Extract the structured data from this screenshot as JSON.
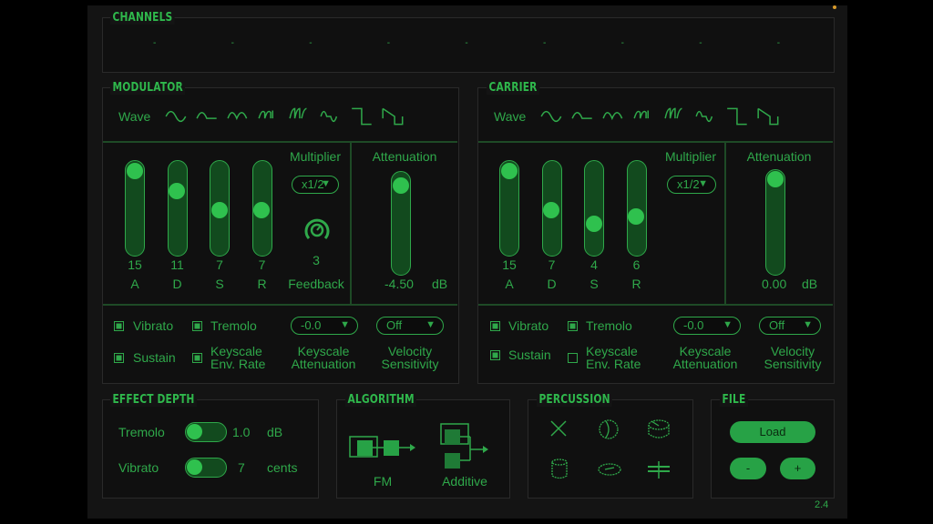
{
  "version": "2.4",
  "channels": {
    "title": "CHANNELS",
    "slots": [
      "-",
      "-",
      "-",
      "-",
      "-",
      "-",
      "-",
      "-",
      "-"
    ]
  },
  "modulator": {
    "title": "MODULATOR",
    "wave_label": "Wave",
    "adsr": {
      "labels": [
        "A",
        "D",
        "S",
        "R"
      ],
      "values": [
        "15",
        "11",
        "7",
        "7"
      ]
    },
    "multiplier_label": "Multiplier",
    "multiplier_value": "x1/2",
    "feedback_value": "3",
    "feedback_label": "Feedback",
    "attenuation_label": "Attenuation",
    "attenuation_value": "-4.50",
    "db_label": "dB",
    "vibrato_label": "Vibrato",
    "tremolo_label": "Tremolo",
    "sustain_label": "Sustain",
    "keyscale_env_label": "Keyscale\nEnv. Rate",
    "keyscale_att_value": "-0.0",
    "keyscale_att_label": "Keyscale\nAttenuation",
    "velocity_value": "Off",
    "velocity_label": "Velocity\nSensitivity"
  },
  "carrier": {
    "title": "CARRIER",
    "wave_label": "Wave",
    "adsr": {
      "labels": [
        "A",
        "D",
        "S",
        "R"
      ],
      "values": [
        "15",
        "7",
        "4",
        "6"
      ]
    },
    "multiplier_label": "Multiplier",
    "multiplier_value": "x1/2",
    "attenuation_label": "Attenuation",
    "attenuation_value": "0.00",
    "db_label": "dB",
    "vibrato_label": "Vibrato",
    "tremolo_label": "Tremolo",
    "sustain_label": "Sustain",
    "keyscale_env_label": "Keyscale\nEnv. Rate",
    "keyscale_att_value": "-0.0",
    "keyscale_att_label": "Keyscale\nAttenuation",
    "velocity_value": "Off",
    "velocity_label": "Velocity\nSensitivity"
  },
  "effect_depth": {
    "title": "EFFECT DEPTH",
    "tremolo_label": "Tremolo",
    "tremolo_value": "1.0",
    "tremolo_unit": "dB",
    "vibrato_label": "Vibrato",
    "vibrato_value": "7",
    "vibrato_unit": "cents"
  },
  "algorithm": {
    "title": "ALGORITHM",
    "fm_label": "FM",
    "additive_label": "Additive"
  },
  "percussion": {
    "title": "PERCUSSION",
    "icons": [
      "crash-icon",
      "tom-icon",
      "snare-icon",
      "bass-drum-icon",
      "hihat-icon",
      "cymbal-icon"
    ]
  },
  "file": {
    "title": "FILE",
    "load_label": "Load",
    "minus_label": "-",
    "plus_label": "+"
  },
  "colors": {
    "accent": "#2fa84a",
    "knob": "#2fc14e",
    "track": "#124a1e",
    "background": "#141414"
  }
}
